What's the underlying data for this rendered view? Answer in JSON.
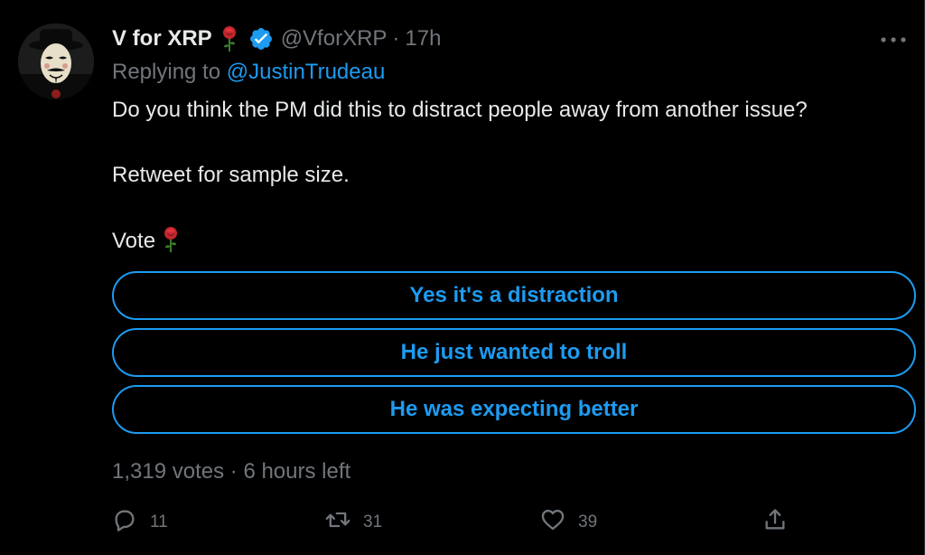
{
  "tweet": {
    "display_name": "V for XRP",
    "handle": "@VforXRP",
    "separator": "·",
    "time": "17h",
    "reply_prefix": "Replying to",
    "reply_mention": "@JustinTrudeau",
    "body_lines": [
      "Do you think the PM did this to distract people away from another issue?",
      "Retweet for sample size.",
      "Vote"
    ]
  },
  "poll": {
    "options": [
      "Yes it's a distraction",
      "He just wanted to troll",
      "He was expecting better"
    ],
    "votes": "1,319 votes",
    "separator": "·",
    "time_left": "6 hours left"
  },
  "actions": {
    "replies": "11",
    "retweets": "31",
    "likes": "39"
  },
  "icons": {
    "more": "more-icon",
    "verified": "verified-badge-icon",
    "rose": "rose-icon",
    "reply": "reply-icon",
    "retweet": "retweet-icon",
    "like": "heart-icon",
    "share": "share-icon"
  },
  "colors": {
    "background": "#000000",
    "text": "#e7e9ea",
    "muted": "#71767b",
    "accent": "#1d9bf0"
  }
}
